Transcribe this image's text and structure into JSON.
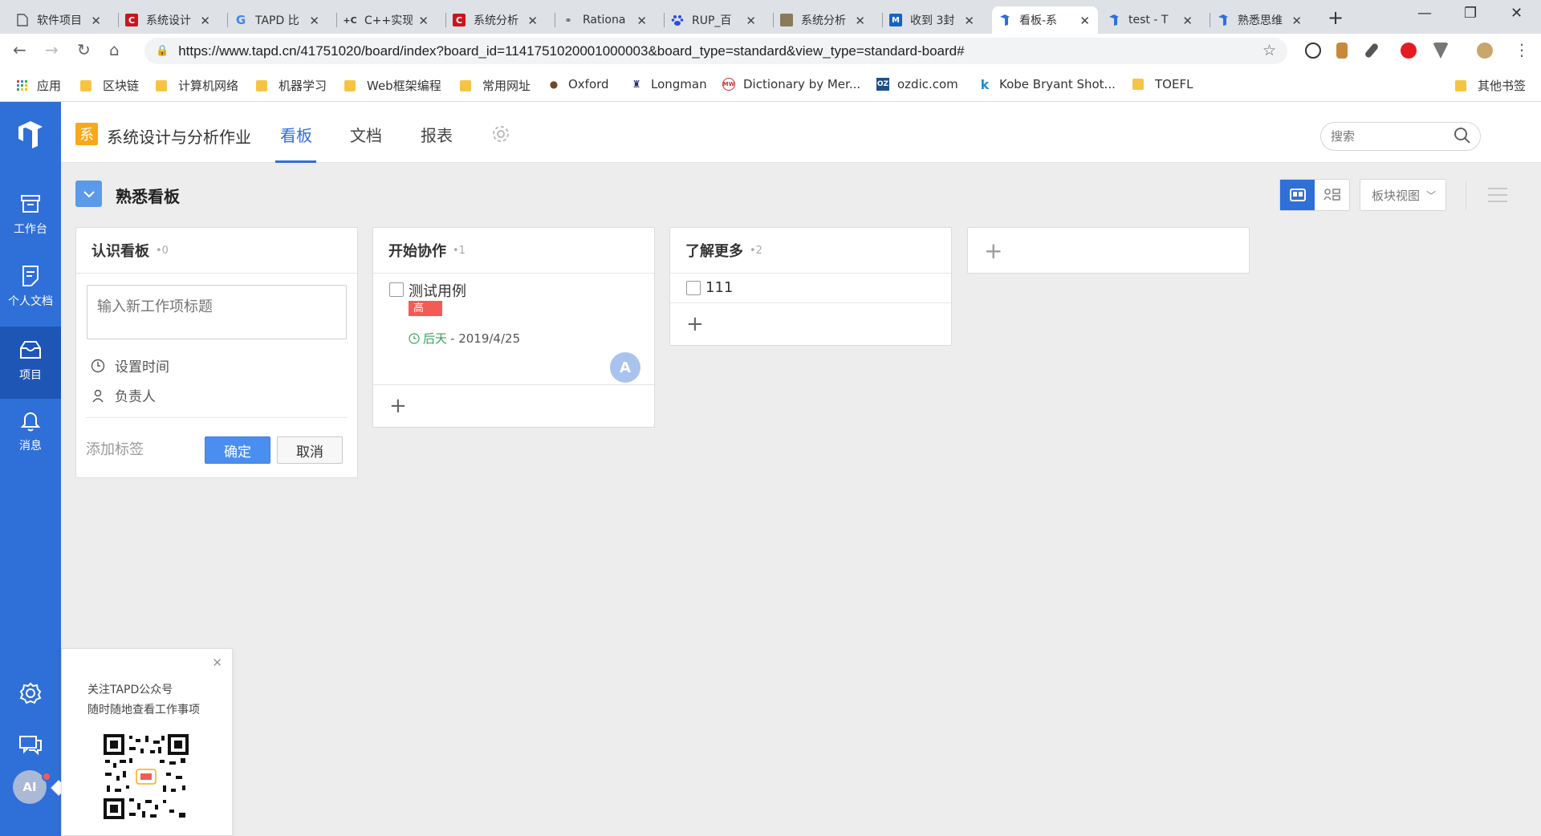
{
  "browser": {
    "tabs": [
      {
        "title": "软件项目",
        "icon": "doc-icon",
        "active": false
      },
      {
        "title": "系统设计",
        "icon": "csdn-icon",
        "active": false
      },
      {
        "title": "TAPD 比",
        "icon": "google-icon",
        "active": false
      },
      {
        "title": "C++实现",
        "icon": "cplus-icon",
        "active": false
      },
      {
        "title": "系统分析",
        "icon": "csdn-icon",
        "active": false
      },
      {
        "title": "Rationa",
        "icon": "link-icon",
        "active": false
      },
      {
        "title": "RUP_百",
        "icon": "baidu-icon",
        "active": false
      },
      {
        "title": "系统分析",
        "icon": "image-icon",
        "active": false
      },
      {
        "title": "收到 3封",
        "icon": "mail-icon",
        "active": false
      },
      {
        "title": "看板-系",
        "icon": "tapd-icon",
        "active": true
      },
      {
        "title": "test - T",
        "icon": "tapd-icon",
        "active": false
      },
      {
        "title": "熟悉思维",
        "icon": "tapd-icon",
        "active": false
      }
    ],
    "url": "https://www.tapd.cn/41751020/board/index?board_id=1141751020001000003&board_type=standard&view_type=standard-board#",
    "bookmarks": [
      {
        "label": "应用",
        "type": "apps"
      },
      {
        "label": "区块链",
        "type": "folder"
      },
      {
        "label": "计算机网络",
        "type": "folder"
      },
      {
        "label": "机器学习",
        "type": "folder"
      },
      {
        "label": "Web框架编程",
        "type": "folder"
      },
      {
        "label": "常用网址",
        "type": "folder"
      },
      {
        "label": "Oxford",
        "type": "site"
      },
      {
        "label": "Longman",
        "type": "site"
      },
      {
        "label": "Dictionary by Mer...",
        "type": "site"
      },
      {
        "label": "ozdic.com",
        "type": "site"
      },
      {
        "label": "Kobe Bryant Shot...",
        "type": "site"
      },
      {
        "label": "TOEFL",
        "type": "folder"
      },
      {
        "label": "其他书签",
        "type": "folder"
      }
    ]
  },
  "sidebar": {
    "items": [
      {
        "label": "工作台",
        "icon": "workbench-icon"
      },
      {
        "label": "个人文档",
        "icon": "document-icon"
      },
      {
        "label": "项目",
        "icon": "project-icon"
      },
      {
        "label": "消息",
        "icon": "bell-icon"
      }
    ],
    "avatar_initials": "AI"
  },
  "header": {
    "project_badge": "系",
    "project_name": "系统设计与分析作业",
    "tabs": [
      "看板",
      "文档",
      "报表"
    ],
    "active_tab": "看板",
    "search_placeholder": "搜索"
  },
  "board": {
    "title": "熟悉看板",
    "view_dropdown": "板块视图",
    "columns": [
      {
        "name": "认识看板",
        "count": "•0",
        "form": {
          "title_placeholder": "输入新工作项标题",
          "set_time": "设置时间",
          "assignee": "负责人",
          "add_tag": "添加标签",
          "confirm": "确定",
          "cancel": "取消"
        }
      },
      {
        "name": "开始协作",
        "count": "•1",
        "cards": [
          {
            "title": "测试用例",
            "priority": "高",
            "due_relative": "后天",
            "due_date": "- 2019/4/25",
            "assignee_initial": "A"
          }
        ]
      },
      {
        "name": "了解更多",
        "count": "•2",
        "cards": [
          {
            "title": "111"
          }
        ]
      }
    ]
  },
  "qr_popup": {
    "line1": "关注TAPD公众号",
    "line2": "随时随地查看工作事项"
  },
  "colors": {
    "sidebar": "#2f6fd8",
    "accent": "#2f6fd8",
    "priority_high": "#f25c54",
    "due_soon": "#36a35a",
    "project_badge": "#f7a91b"
  }
}
